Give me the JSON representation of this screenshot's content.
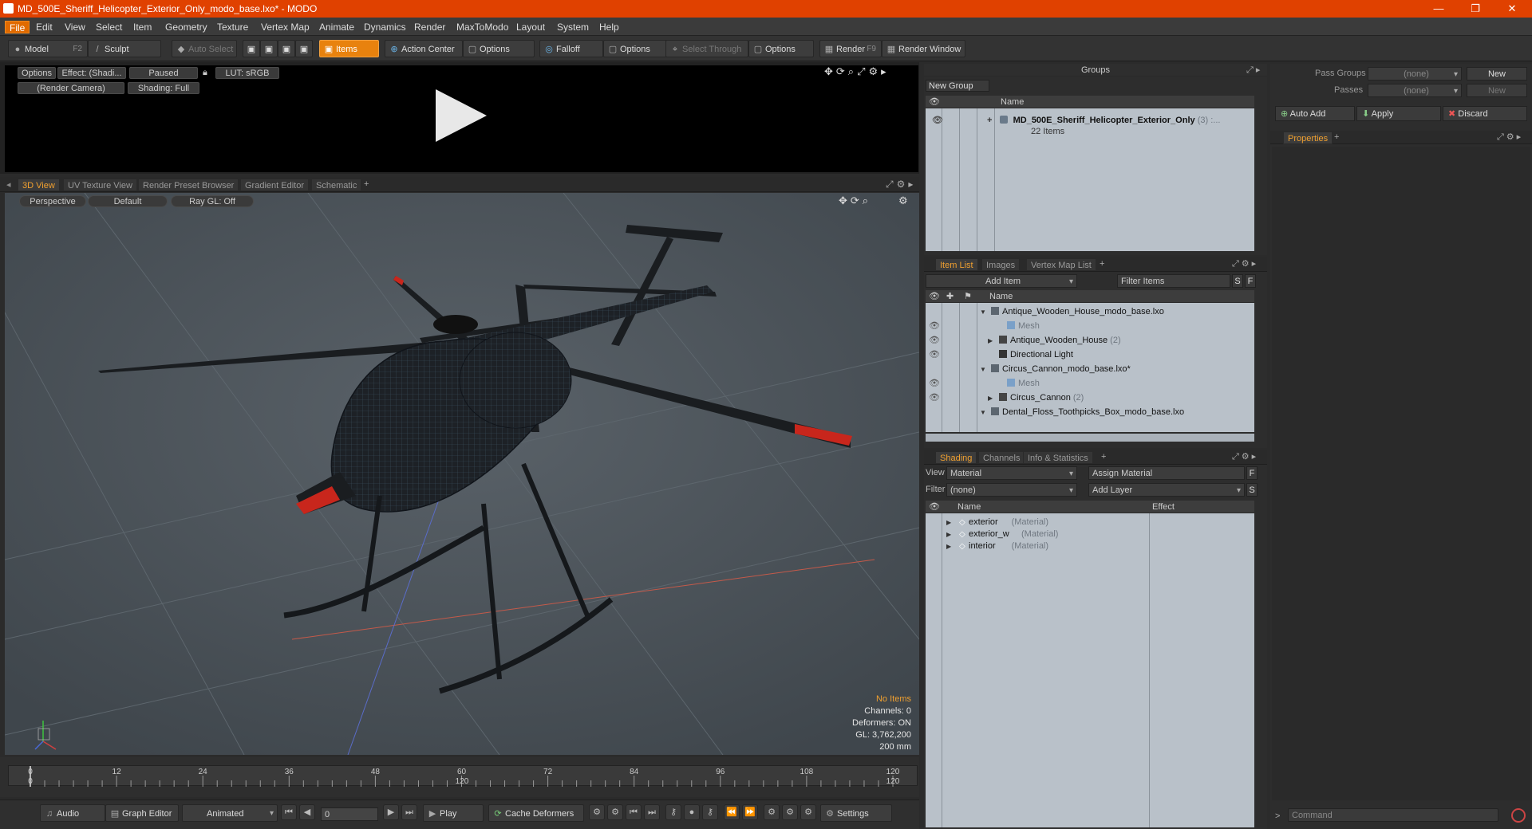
{
  "window": {
    "title": "MD_500E_Sheriff_Helicopter_Exterior_Only_modo_base.lxo* - MODO",
    "minimize": "—",
    "restore": "❐",
    "close": "✕"
  },
  "menu": [
    "File",
    "Edit",
    "View",
    "Select",
    "Item",
    "Geometry",
    "Texture",
    "Vertex Map",
    "Animate",
    "Dynamics",
    "Render",
    "MaxToModo",
    "Layout",
    "System",
    "Help"
  ],
  "toolbar": {
    "model": "Model",
    "model_key": "F2",
    "sculpt": "Sculpt",
    "auto_select": "Auto Select",
    "items": "Items",
    "action_center": "Action Center",
    "options1": "Options",
    "falloff": "Falloff",
    "options2": "Options",
    "select_through": "Select Through",
    "options3": "Options",
    "render": "Render",
    "render_key": "F9",
    "render_window": "Render Window"
  },
  "preview": {
    "options": "Options",
    "effect": "Effect: (Shadi...",
    "paused": "Paused",
    "lut": "LUT: sRGB",
    "camera": "(Render Camera)",
    "shading": "Shading: Full"
  },
  "view_tabs": [
    "3D View",
    "UV Texture View",
    "Render Preset Browser",
    "Gradient Editor",
    "Schematic",
    "+"
  ],
  "viewport": {
    "perspective": "Perspective",
    "default": "Default",
    "raygl": "Ray GL: Off",
    "no_items": "No Items",
    "channels": "Channels: 0",
    "deformers": "Deformers: ON",
    "gl": "GL: 3,762,200",
    "scale": "200 mm"
  },
  "groups": {
    "title": "Groups",
    "new_group": "New Group",
    "col_name": "Name",
    "item_name": "MD_500E_Sheriff_Helicopter_Exterior_Only",
    "item_count": "(3) :...",
    "item_sub": "22 Items"
  },
  "item_list": {
    "tabs": [
      "Item List",
      "Images",
      "Vertex Map List",
      "+"
    ],
    "add_item": "Add Item",
    "filter": "Filter Items",
    "s": "S",
    "f": "F",
    "col_name": "Name",
    "rows": [
      {
        "label": "Antique_Wooden_House_modo_base.lxo",
        "suffix": "",
        "kind": "scene",
        "indent": 0,
        "eye": false,
        "arrow": "▼"
      },
      {
        "label": "Mesh",
        "suffix": "",
        "kind": "mesh",
        "indent": 2,
        "eye": true,
        "arrow": ""
      },
      {
        "label": "Antique_Wooden_House",
        "suffix": "(2)",
        "kind": "group",
        "indent": 1,
        "eye": true,
        "arrow": "▶"
      },
      {
        "label": "Directional Light",
        "suffix": "",
        "kind": "light",
        "indent": 1,
        "eye": true,
        "arrow": ""
      },
      {
        "label": "Circus_Cannon_modo_base.lxo*",
        "suffix": "",
        "kind": "scene",
        "indent": 0,
        "eye": false,
        "arrow": "▼"
      },
      {
        "label": "Mesh",
        "suffix": "",
        "kind": "mesh",
        "indent": 2,
        "eye": true,
        "arrow": ""
      },
      {
        "label": "Circus_Cannon",
        "suffix": "(2)",
        "kind": "group",
        "indent": 1,
        "eye": true,
        "arrow": "▶"
      },
      {
        "label": "Dental_Floss_Toothpicks_Box_modo_base.lxo",
        "suffix": "",
        "kind": "scene",
        "indent": 0,
        "eye": false,
        "arrow": "▼"
      }
    ]
  },
  "shading": {
    "tabs": [
      "Shading",
      "Channels",
      "Info & Statistics",
      "+"
    ],
    "view_label": "View",
    "view_value": "Material",
    "assign": "Assign Material",
    "filter_label": "Filter",
    "filter_value": "(none)",
    "add_layer": "Add Layer",
    "f": "F",
    "s": "S",
    "col_name": "Name",
    "col_effect": "Effect",
    "rows": [
      {
        "label": "exterior",
        "type": "(Material)"
      },
      {
        "label": "exterior_w",
        "type": "(Material)"
      },
      {
        "label": "interior",
        "type": "(Material)"
      }
    ]
  },
  "right": {
    "pass_groups": "Pass Groups",
    "passes": "Passes",
    "none1": "(none)",
    "none2": "(none)",
    "new1": "New",
    "new2": "New",
    "auto_add": "Auto Add",
    "apply": "Apply",
    "discard": "Discard",
    "properties": "Properties",
    "plus": "+"
  },
  "timeline": {
    "ticks": [
      "0",
      "12",
      "24",
      "36",
      "48",
      "60",
      "72",
      "84",
      "96",
      "108",
      "120"
    ],
    "sub_ticks": [
      "0",
      "120",
      "120"
    ]
  },
  "bottom": {
    "audio": "Audio",
    "graph_editor": "Graph Editor",
    "animated": "Animated",
    "frame": "0",
    "play": "Play",
    "cache": "Cache Deformers",
    "settings": "Settings",
    "command": "Command"
  }
}
